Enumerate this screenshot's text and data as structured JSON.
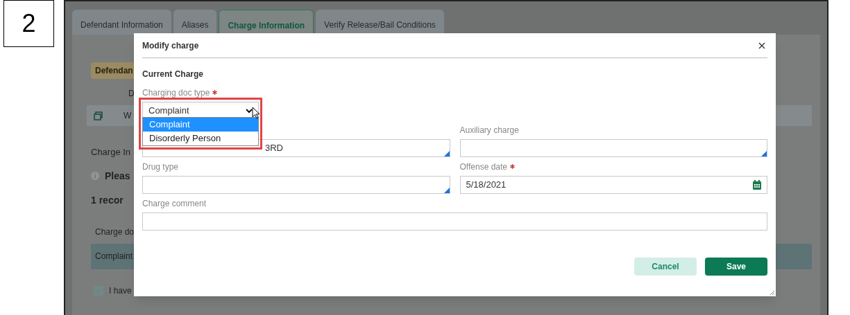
{
  "step": "2",
  "tabs": [
    {
      "label": "Defendant Information",
      "selected": false
    },
    {
      "label": "Aliases",
      "selected": false
    },
    {
      "label": "Charge Information",
      "selected": true
    },
    {
      "label": "Verify Release/Bail Conditions",
      "selected": false
    }
  ],
  "background": {
    "badge": "Defendan",
    "detail_text": "D",
    "notice_text": "W",
    "section_title": "Charge In",
    "info_text": "Pleas",
    "record_count": "1 recor",
    "column_header": "Charge do",
    "row_cell": "Complaint",
    "checkbox": {
      "label": "I have",
      "checked": true
    }
  },
  "modal": {
    "title": "Modify charge",
    "section": "Current Charge",
    "fields": [
      {
        "kind": "select",
        "label": "Charging doc type",
        "required": true,
        "value": "Complaint",
        "expanded": true,
        "options": [
          {
            "label": "Complaint",
            "selected": true
          },
          {
            "label": "Disorderly Person",
            "selected": false
          }
        ]
      },
      {
        "kind": "lookup",
        "value": "3RD"
      },
      {
        "kind": "lookup",
        "label": "Auxiliary charge",
        "required": false
      },
      {
        "kind": "lookup",
        "label": "Drug type",
        "required": false
      },
      {
        "kind": "date",
        "label": "Offense date",
        "required": true,
        "value": "5/18/2021"
      },
      {
        "kind": "text",
        "label": "Charge comment",
        "required": false
      }
    ],
    "buttons": [
      {
        "label": "Cancel",
        "kind": "secondary"
      },
      {
        "label": "Save",
        "kind": "primary"
      }
    ]
  }
}
